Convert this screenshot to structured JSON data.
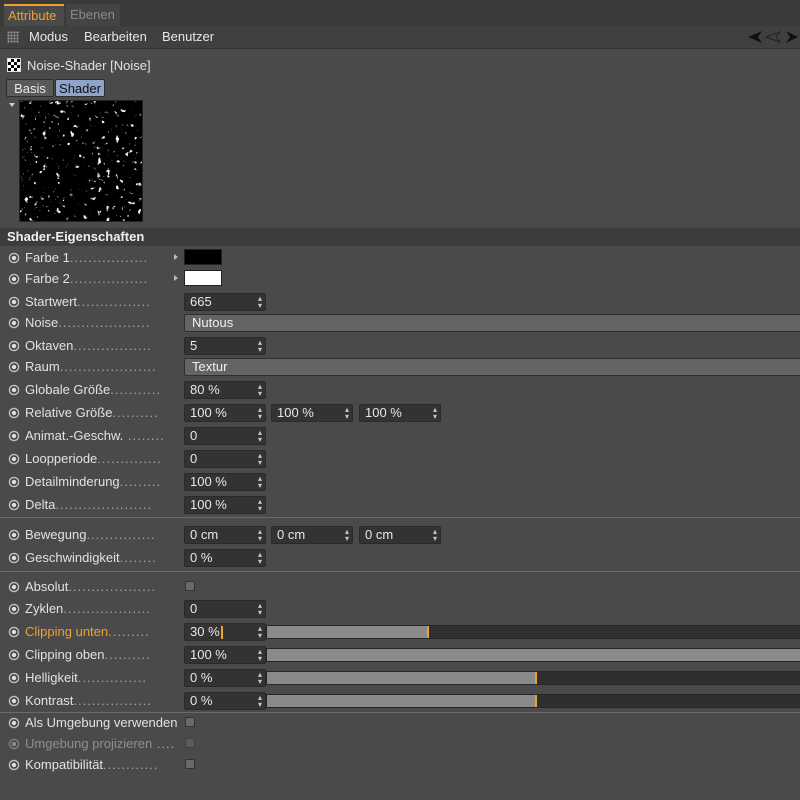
{
  "tabs": [
    {
      "label": "Attribute",
      "active": true
    },
    {
      "label": "Ebenen",
      "active": false
    }
  ],
  "menu": [
    "Modus",
    "Bearbeiten",
    "Benutzer"
  ],
  "object_title": "Noise-Shader [Noise]",
  "panel_tabs": [
    {
      "label": "Basis",
      "active": false
    },
    {
      "label": "Shader",
      "active": true
    }
  ],
  "section_title": "Shader-Eigenschaften",
  "colors": {
    "accent": "#f0a030",
    "selected_tab": "#8fa4c8",
    "background": "#4a4a4a"
  },
  "properties": {
    "farbe1": {
      "label": "Farbe 1",
      "swatch": "#000000"
    },
    "farbe2": {
      "label": "Farbe 2",
      "swatch": "#ffffff"
    },
    "startwert": {
      "label": "Startwert",
      "value": "665"
    },
    "noise": {
      "label": "Noise",
      "value": "Nutous"
    },
    "oktaven": {
      "label": "Oktaven",
      "value": "5"
    },
    "raum": {
      "label": "Raum",
      "value": "Textur"
    },
    "globale_groesse": {
      "label": "Globale Größe",
      "value": "80 %"
    },
    "relative_groesse": {
      "label": "Relative Größe",
      "values": [
        "100 %",
        "100 %",
        "100 %"
      ]
    },
    "animat_geschw": {
      "label": "Animat.-Geschw.",
      "value": "0"
    },
    "loopperiode": {
      "label": "Loopperiode",
      "value": "0"
    },
    "detailminderung": {
      "label": "Detailminderung",
      "value": "100 %"
    },
    "delta": {
      "label": "Delta",
      "value": "100 %"
    },
    "bewegung": {
      "label": "Bewegung",
      "values": [
        "0 cm",
        "0 cm",
        "0 cm"
      ]
    },
    "geschwindigkeit": {
      "label": "Geschwindigkeit",
      "value": "0 %"
    },
    "absolut": {
      "label": "Absolut",
      "checked": false
    },
    "zyklen": {
      "label": "Zyklen",
      "value": "0"
    },
    "clipping_unten": {
      "label": "Clipping unten",
      "value": "30 %",
      "slider": 0.3
    },
    "clipping_oben": {
      "label": "Clipping oben",
      "value": "100 %",
      "slider": 1.0
    },
    "helligkeit": {
      "label": "Helligkeit",
      "value": "0 %",
      "slider": 0.5
    },
    "kontrast": {
      "label": "Kontrast",
      "value": "0 %",
      "slider": 0.5
    },
    "als_umgebung": {
      "label": "Als Umgebung verwenden",
      "checked": false
    },
    "umgebung_projizieren": {
      "label": "Umgebung projizieren",
      "checked": false
    },
    "kompatibilitaet": {
      "label": "Kompatibilität",
      "checked": false
    }
  }
}
